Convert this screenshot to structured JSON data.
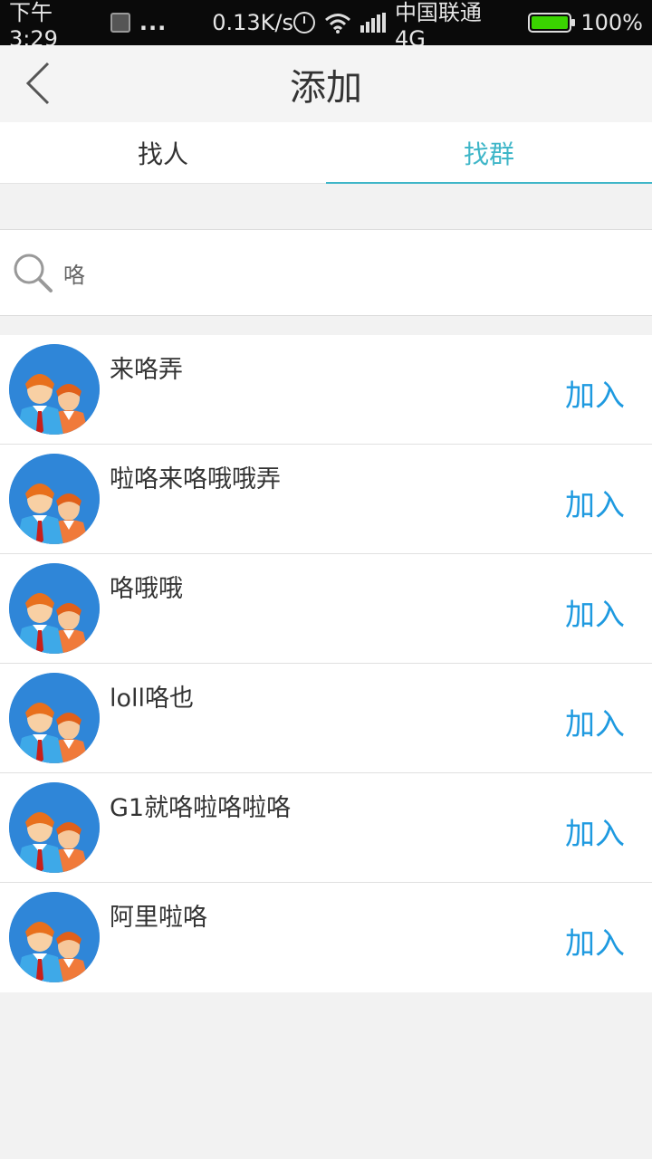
{
  "status_bar": {
    "time": "下午3:29",
    "dots": "...",
    "speed": "0.13K/s",
    "carrier": "中国联通 4G",
    "battery": "100%",
    "battery_color": "#3ad400"
  },
  "header": {
    "title": "添加",
    "back_icon": "chevron-left-icon"
  },
  "tabs": [
    {
      "label": "找人",
      "active": false
    },
    {
      "label": "找群",
      "active": true
    }
  ],
  "search": {
    "icon": "search-icon",
    "value": "咯"
  },
  "results": [
    {
      "name": "来咯弄",
      "action": "加入"
    },
    {
      "name": "啦咯来咯哦哦弄",
      "action": "加入"
    },
    {
      "name": "咯哦哦",
      "action": "加入"
    },
    {
      "name": "loll咯也",
      "action": "加入"
    },
    {
      "name": "G1就咯啦咯啦咯",
      "action": "加入"
    },
    {
      "name": "阿里啦咯",
      "action": "加入"
    }
  ],
  "colors": {
    "accent": "#3fb6c8",
    "action": "#1e9ae0",
    "avatar_bg": "#2f86d8"
  }
}
